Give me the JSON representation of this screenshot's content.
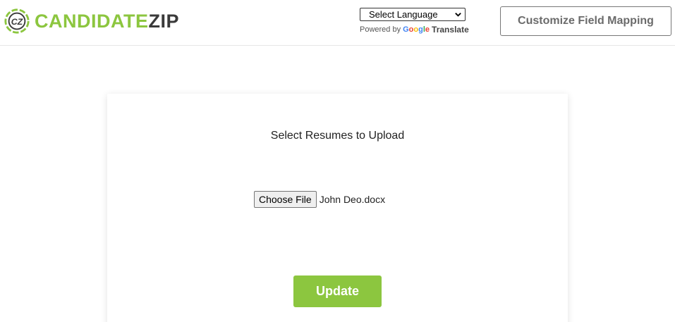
{
  "brand": {
    "logo_part1": "CANDIDATE",
    "logo_part2": "ZIP",
    "primary_color": "#8cc63f",
    "dark_color": "#3a3a3a"
  },
  "language": {
    "selected": "Select Language",
    "powered_by": "Powered by",
    "google": [
      "G",
      "o",
      "o",
      "g",
      "l",
      "e"
    ],
    "translate": "Translate"
  },
  "header": {
    "customize_label": "Customize Field Mapping"
  },
  "upload": {
    "title": "Select Resumes to Upload",
    "choose_label": "Choose File",
    "file_name": "John Deo.docx",
    "update_label": "Update"
  }
}
